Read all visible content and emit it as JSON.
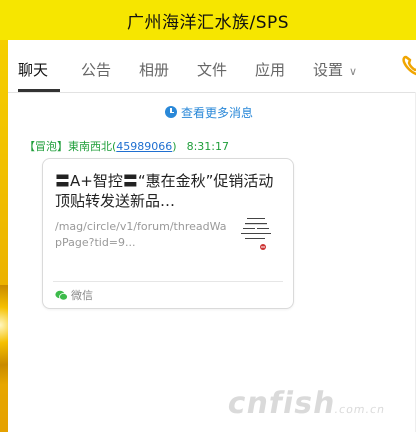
{
  "window": {
    "title": "广州海洋汇水族/SPS"
  },
  "tabs": [
    {
      "label": "聊天",
      "active": true
    },
    {
      "label": "公告"
    },
    {
      "label": "相册"
    },
    {
      "label": "文件"
    },
    {
      "label": "应用"
    },
    {
      "label": "设置"
    }
  ],
  "history": {
    "label": "查看更多消息"
  },
  "message": {
    "sender_tag": "【冒泡】",
    "sender_name": "東南西北",
    "sender_id": "45989066",
    "time": "8:31:17",
    "card": {
      "title": "〓A+智控〓“惠在金秋”促销活动顶贴转发送新品…",
      "url": "/mag/circle/v1/forum/threadWapPage?tid=9...",
      "source": "微信",
      "source_icon": "wechat-icon"
    }
  },
  "watermark": {
    "text": "cnfish",
    "suffix": ".com.cn"
  },
  "colors": {
    "titlebar": "#f6e600",
    "link": "#2a88d8",
    "sender": "#1f9e3a",
    "accent_phone": "#f0a500"
  }
}
